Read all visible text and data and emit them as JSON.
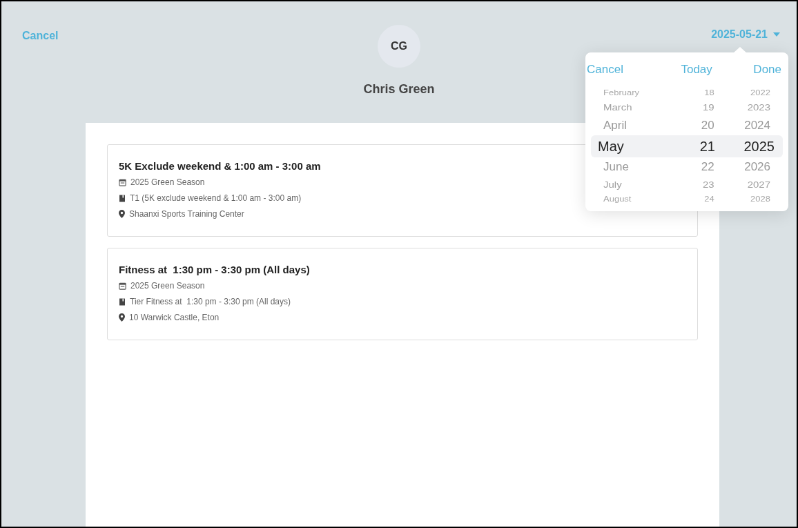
{
  "header": {
    "cancel": "Cancel",
    "avatar_initials": "CG",
    "name": "Chris Green",
    "date": "2025-05-21"
  },
  "sessions": [
    {
      "title": "5K Exclude weekend & 1:00 am - 3:00 am",
      "season": "2025 Green Season",
      "tier": "T1 (5K exclude weekend & 1:00 am - 3:00 am)",
      "location": "Shaanxi Sports Training Center"
    },
    {
      "title": "Fitness at  1:30 pm - 3:30 pm (All days)",
      "season": "2025 Green Season",
      "tier": "Tier Fitness at  1:30 pm - 3:30 pm (All days)",
      "location": "10 Warwick Castle, Eton"
    }
  ],
  "date_picker": {
    "cancel": "Cancel",
    "today": "Today",
    "done": "Done",
    "rows": [
      {
        "month": "February",
        "day": "18",
        "year": "2022",
        "selected": false
      },
      {
        "month": "March",
        "day": "19",
        "year": "2023",
        "selected": false
      },
      {
        "month": "April",
        "day": "20",
        "year": "2024",
        "selected": false
      },
      {
        "month": "May",
        "day": "21",
        "year": "2025",
        "selected": true
      },
      {
        "month": "June",
        "day": "22",
        "year": "2026",
        "selected": false
      },
      {
        "month": "July",
        "day": "23",
        "year": "2027",
        "selected": false
      },
      {
        "month": "August",
        "day": "24",
        "year": "2028",
        "selected": false
      }
    ]
  }
}
